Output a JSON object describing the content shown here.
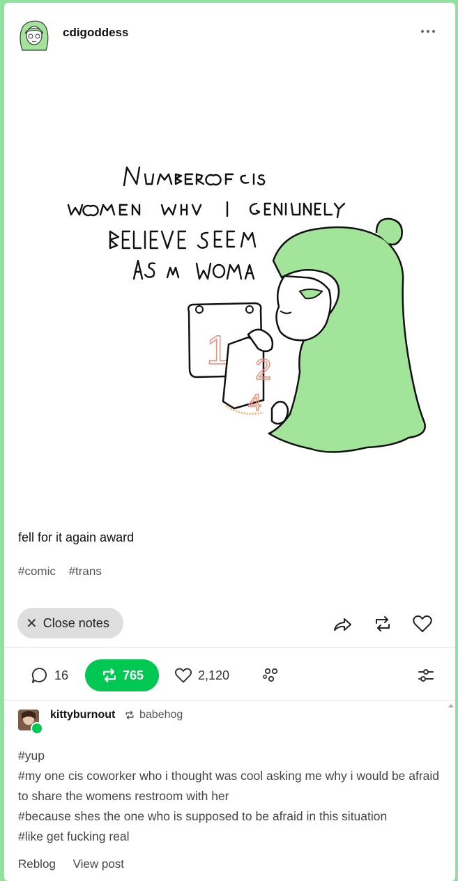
{
  "post": {
    "author": "cdigoddess",
    "comic_text": "NUMBER OF CIS WOMEN WHO I GENIUNELY BELIEVE SEE ME AS A WOMAN",
    "comic_card_numbers": [
      "1",
      "2",
      "4"
    ],
    "caption": "fell for it again award",
    "tags": [
      "#comic",
      "#trans"
    ]
  },
  "actions": {
    "close_notes_label": "Close notes",
    "share_icon": "share-icon",
    "reblog_icon": "reblog-icon",
    "like_icon": "heart-icon"
  },
  "notes_bar": {
    "replies": "16",
    "reblogs": "765",
    "likes": "2,120"
  },
  "note": {
    "user": "kittyburnout",
    "via": "babehog",
    "lines": [
      "#yup",
      "#my one cis coworker who i thought was cool asking me why i would be afraid to share the womens restroom with her",
      "#because shes the one who is supposed to be afraid in this situation",
      "#like get fucking real"
    ],
    "reblog_label": "Reblog",
    "view_post_label": "View post"
  },
  "colors": {
    "page_bg": "#8ee3a0",
    "accent_green": "#00c853",
    "character_green": "#a3e49b"
  }
}
